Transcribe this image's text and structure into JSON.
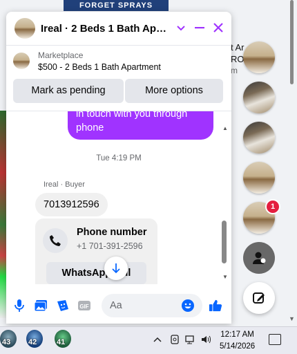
{
  "background": {
    "banner": "FORGET SPRAYS",
    "snippet_line1": "t Ar",
    "snippet_line2": "RO",
    "snippet_line3": "m"
  },
  "chat": {
    "title": "Ireal · 2 Beds 1 Bath Apart…",
    "marketplace_label": "Marketplace",
    "listing": "$500 - 2 Beds 1 Bath Apartment",
    "mark_pending": "Mark as pending",
    "more_options": "More options",
    "outgoing_line1": "in touch with you through",
    "outgoing_line2": "phone",
    "timestamp": "Tue 4:19 PM",
    "sender": "Ireal · Buyer",
    "incoming_phone": "7013912596",
    "card_title": "Phone number",
    "card_number": "+1 701-391-2596",
    "whatsapp": "WhatsApp call",
    "input_placeholder": "Aa"
  },
  "chat_heads": {
    "unread_badge": "1"
  },
  "taskbar": {
    "app1_count": "43",
    "app2_count": "42",
    "app3_count": "41",
    "time": "12:17 AM",
    "date": "5/14/2026"
  },
  "colors": {
    "accent": "#a033ff",
    "messenger_blue": "#0866ff",
    "badge": "#e41e3f"
  },
  "icons": {
    "header": [
      "chevron-down-icon",
      "minimize-icon",
      "close-icon"
    ],
    "composer": [
      "microphone-icon",
      "gallery-icon",
      "sticker-icon",
      "gif-icon",
      "emoji-icon",
      "like-icon"
    ],
    "side": [
      "contacts-icon",
      "compose-icon"
    ]
  }
}
